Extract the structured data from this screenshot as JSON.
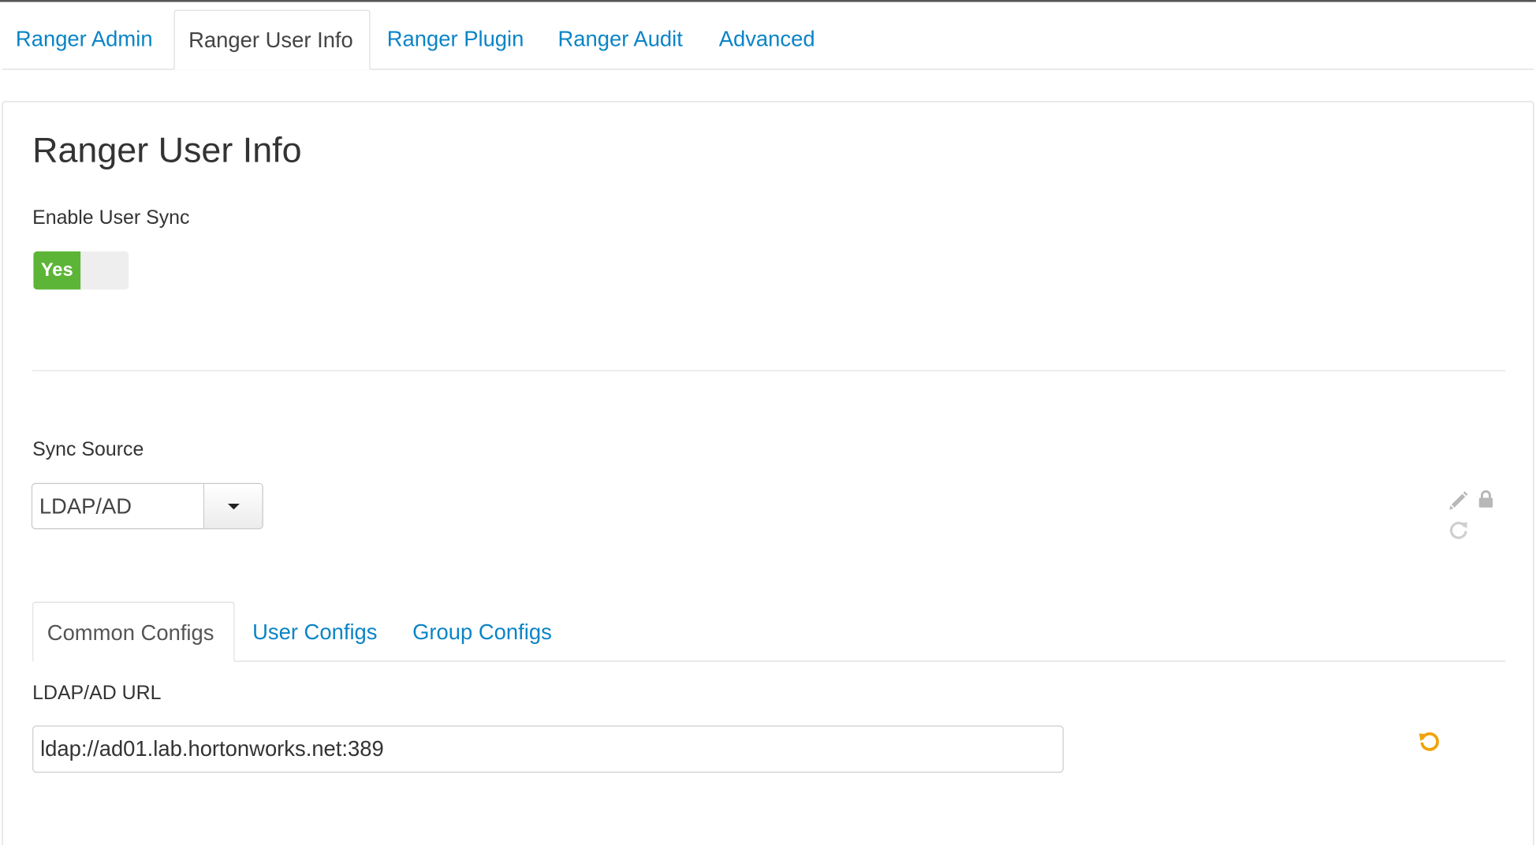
{
  "tabs": [
    {
      "label": "Ranger Admin",
      "active": false
    },
    {
      "label": "Ranger User Info",
      "active": true
    },
    {
      "label": "Ranger Plugin",
      "active": false
    },
    {
      "label": "Ranger Audit",
      "active": false
    },
    {
      "label": "Advanced",
      "active": false
    }
  ],
  "section": {
    "title": "Ranger User Info",
    "enable_sync": {
      "label": "Enable User Sync",
      "toggle_label": "Yes",
      "enabled": true
    },
    "sync_source": {
      "label": "Sync Source",
      "selected": "LDAP/AD"
    },
    "config_actions": {
      "icons": [
        "pencil-icon",
        "lock-icon",
        "refresh-icon"
      ]
    },
    "config_tabs": [
      {
        "label": "Common Configs",
        "active": true
      },
      {
        "label": "User Configs",
        "active": false
      },
      {
        "label": "Group Configs",
        "active": false
      }
    ],
    "ldap_url": {
      "label": "LDAP/AD URL",
      "value": "ldap://ad01.lab.hortonworks.net:389",
      "undo_icon": "undo-icon"
    }
  },
  "colors": {
    "link": "#0a84c6",
    "toggle_on": "#5cb536",
    "undo_icon": "#f0a30a",
    "muted_icon": "#b8b8b8"
  }
}
